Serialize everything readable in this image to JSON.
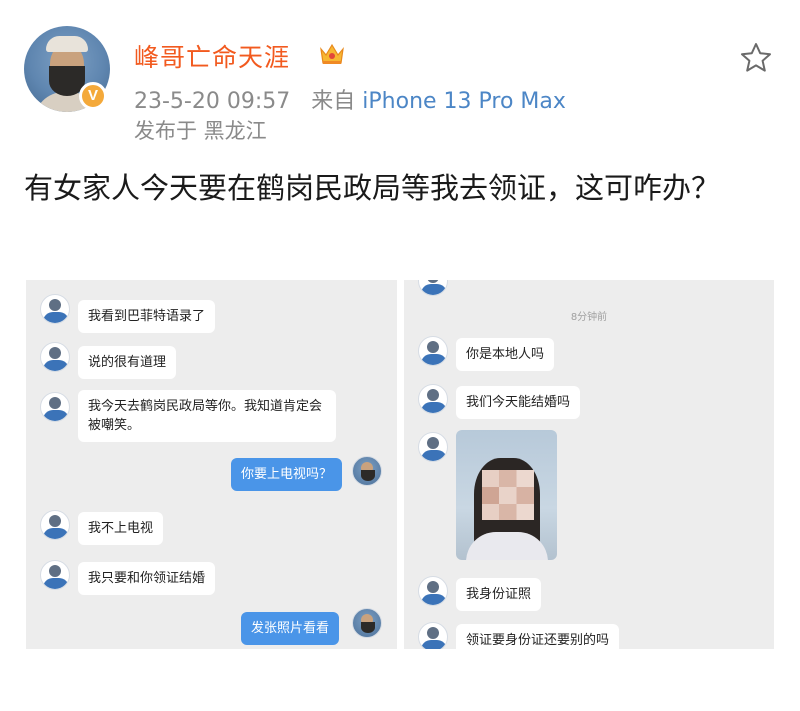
{
  "post": {
    "username": "峰哥亡命天涯",
    "timestamp": "23-5-20 09:57",
    "source_prefix": "来自",
    "source_device": "iPhone 13 Pro Max",
    "location": "发布于 黑龙江",
    "text": "有女家人今天要在鹤岗民政局等我去领证，这可咋办？"
  },
  "chat_left": {
    "messages": [
      {
        "from": "them",
        "text": "我看到巴菲特语录了"
      },
      {
        "from": "them",
        "text": "说的很有道理"
      },
      {
        "from": "them",
        "text": "我今天去鹤岗民政局等你。我知道肯定会被嘲笑。"
      },
      {
        "from": "me",
        "text": "你要上电视吗？"
      },
      {
        "from": "them",
        "text": "我不上电视"
      },
      {
        "from": "them",
        "text": "我只要和你领证结婚"
      },
      {
        "from": "me",
        "text": "发张照片看看"
      }
    ]
  },
  "chat_right": {
    "timestamp": "8分钟前",
    "messages": [
      {
        "from": "them",
        "text": "你是本地人吗"
      },
      {
        "from": "them",
        "text": "我们今天能结婚吗"
      },
      {
        "from": "them",
        "text": "我身份证照"
      },
      {
        "from": "them",
        "text": "领证要身份证还要别的吗"
      }
    ]
  },
  "colors": {
    "username": "#f25a1f",
    "source": "#4c86c6",
    "meta": "#8a8a8a",
    "my_bubble": "#4a95e8",
    "chat_bg": "#ededed"
  },
  "icons": [
    "crown-icon",
    "verified-badge-icon",
    "star-icon"
  ]
}
